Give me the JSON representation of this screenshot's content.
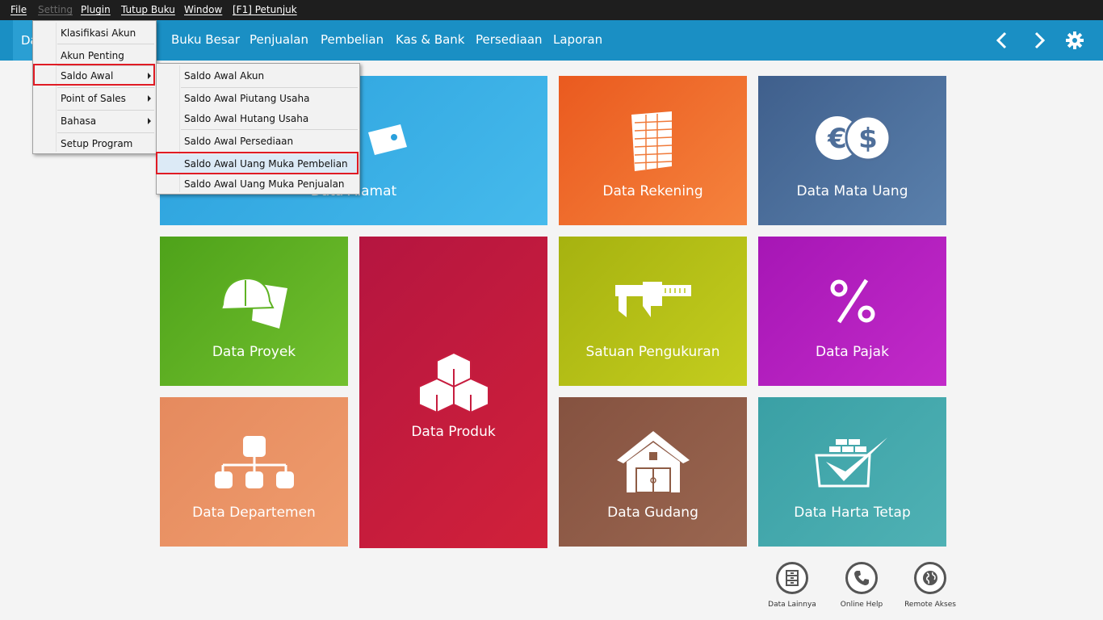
{
  "menubar": {
    "items": [
      {
        "label": "File"
      },
      {
        "label": "Setting"
      },
      {
        "label": "Plugin"
      },
      {
        "label": "Tutup Buku"
      },
      {
        "label": "Window"
      },
      {
        "label": "[F1] Petunjuk"
      }
    ]
  },
  "navbar": {
    "first_tab": "Data",
    "items": [
      "Buku Besar",
      "Penjualan",
      "Pembelian",
      "Kas & Bank",
      "Persediaan",
      "Laporan"
    ],
    "icons": [
      "chevron-left-icon",
      "chevron-right-icon",
      "gear-icon"
    ]
  },
  "tiles": {
    "alamat": {
      "label": "Data Alamat",
      "color": "#3ab1e6"
    },
    "rekening": {
      "label": "Data Rekening",
      "color": "#f06d2c"
    },
    "mata_uang": {
      "label": "Data Mata Uang",
      "color": "#4f6f9a"
    },
    "proyek": {
      "label": "Data Proyek",
      "color": "#5fb324"
    },
    "produk": {
      "label": "Data Produk",
      "color": "#c71d3f"
    },
    "satuan": {
      "label": "Satuan Pengukuran",
      "color": "#b9c414"
    },
    "pajak": {
      "label": "Data Pajak",
      "color": "#b91fbf"
    },
    "departemen": {
      "label": "Data Departemen",
      "color": "#e99367"
    },
    "gudang": {
      "label": "Data Gudang",
      "color": "#8e5c45"
    },
    "harta_tetap": {
      "label": "Data Harta Tetap",
      "color": "#43a7ab"
    }
  },
  "bottom_buttons": [
    {
      "label": "Data Lainnya",
      "icon": "cabinet-icon"
    },
    {
      "label": "Online Help",
      "icon": "phone-icon"
    },
    {
      "label": "Remote Akses",
      "icon": "globe-icon"
    }
  ],
  "setting_menu": {
    "items": [
      {
        "label": "Klasifikasi Akun"
      },
      {
        "label": "Akun Penting"
      },
      {
        "label": "Saldo Awal"
      },
      {
        "label": "Point of Sales"
      },
      {
        "label": "Bahasa"
      },
      {
        "label": "Setup Program"
      }
    ]
  },
  "saldo_awal_submenu": {
    "items": [
      {
        "label": "Saldo Awal Akun"
      },
      {
        "label": "Saldo Awal Piutang Usaha"
      },
      {
        "label": "Saldo Awal Hutang Usaha"
      },
      {
        "label": "Saldo Awal Persediaan"
      },
      {
        "label": "Saldo Awal Uang Muka Pembelian"
      },
      {
        "label": "Saldo Awal Uang Muka Penjualan"
      }
    ]
  }
}
